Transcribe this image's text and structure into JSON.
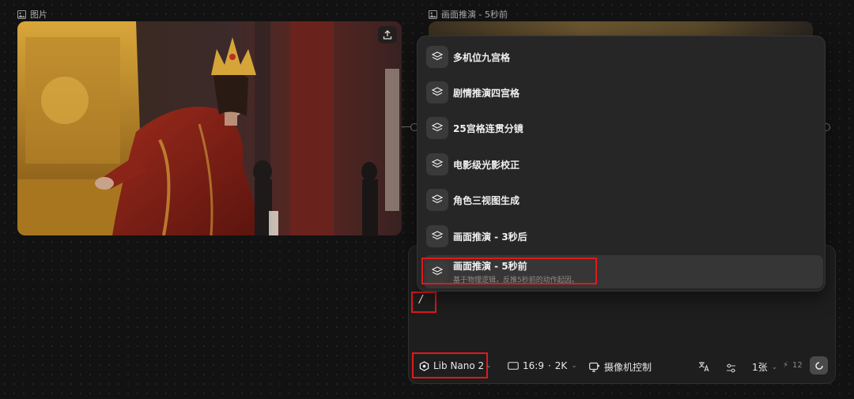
{
  "image_node": {
    "label": "图片"
  },
  "result_node": {
    "label": "画面推演 - 5秒前"
  },
  "menu": {
    "items": [
      {
        "label": "多机位九宫格",
        "desc": ""
      },
      {
        "label": "剧情推演四宫格",
        "desc": ""
      },
      {
        "label": "25宫格连贯分镜",
        "desc": ""
      },
      {
        "label": "电影级光影校正",
        "desc": ""
      },
      {
        "label": "角色三视图生成",
        "desc": ""
      },
      {
        "label": "画面推演 - 3秒后",
        "desc": ""
      },
      {
        "label": "画面推演 - 5秒前",
        "desc": "基于物理逻辑，反推5秒前的动作起因。"
      }
    ]
  },
  "prompt": {
    "value": "/"
  },
  "toolbar": {
    "model": "Lib Nano 2",
    "ratio": "16:9",
    "separator": "·",
    "resolution": "2K",
    "camera": "摄像机控制",
    "count": "1张",
    "credits": "12"
  },
  "colors": {
    "highlight": "#e0191b",
    "background": "#121212"
  }
}
